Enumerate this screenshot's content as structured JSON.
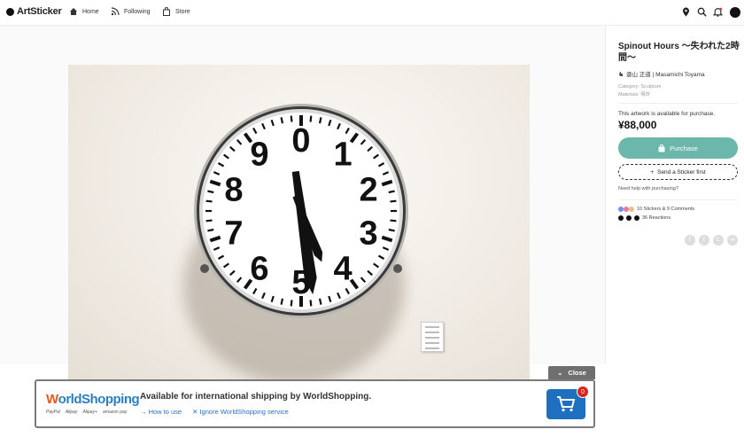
{
  "header": {
    "logo": "ArtSticker",
    "nav": [
      {
        "label": "Home",
        "icon": "home-icon"
      },
      {
        "label": "Following",
        "icon": "rss-icon"
      },
      {
        "label": "Store",
        "icon": "bag-icon"
      }
    ],
    "right_icons": [
      "location-pin-icon",
      "search-icon",
      "bell-icon",
      "user-avatar"
    ]
  },
  "artwork": {
    "title": "Spinout Hours 〜失われた2時間〜",
    "artist": "遠山 正道 | Masamichi Toyama",
    "category": "Category: Sculpture",
    "materials": "Materials: 時計",
    "clock_numerals": [
      "0",
      "1",
      "2",
      "3",
      "4",
      "5",
      "6",
      "7",
      "8",
      "9"
    ]
  },
  "purchase": {
    "availability": "This artwork is available for purchase.",
    "price": "¥88,000",
    "purchase_label": "Purchase",
    "sticker_label": "Send a Sticker first",
    "help_label": "Need help with purchasing?"
  },
  "stats": {
    "stickers": "10 Stickers & 9 Comments",
    "reactions": "36 Reactions"
  },
  "share_icons": [
    "facebook-icon",
    "twitter-icon",
    "line-icon",
    "link-icon"
  ],
  "worldshopping": {
    "close_label": "Close",
    "logo_main": "orldShopping",
    "logo_w": "W",
    "payments": [
      "PayPal",
      "Alipay",
      "Alipay+",
      "amazon pay"
    ],
    "message": "Available for international shipping by WorldShopping.",
    "how_to_use": "→ How to use",
    "ignore": "✕ Ignore WorldShopping service",
    "cart_count": "0"
  },
  "colors": {
    "accent": "#6cb7ac",
    "ws_blue": "#1e6fc0",
    "badge_red": "#d9261c"
  }
}
